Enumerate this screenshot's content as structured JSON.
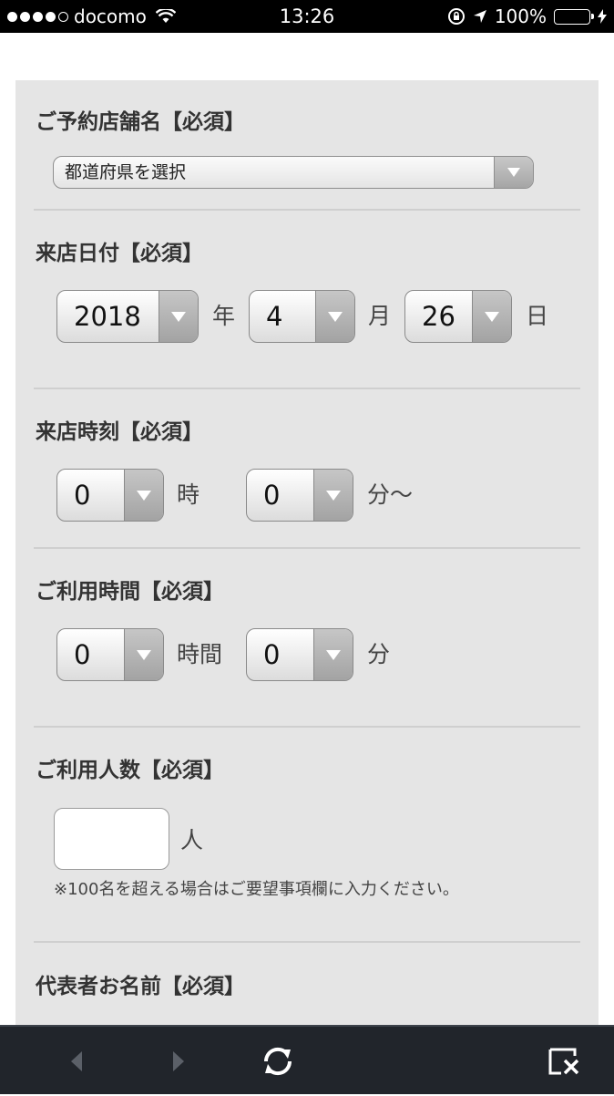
{
  "status_bar": {
    "carrier": "docomo",
    "time": "13:26",
    "battery": "100%",
    "signal_bars": 4,
    "signal_total": 5
  },
  "form": {
    "store": {
      "label": "ご予約店舗名【必須】",
      "prefecture_select": "都道府県を選択"
    },
    "visit_date": {
      "label": "来店日付【必須】",
      "year": "2018",
      "year_unit": "年",
      "month": "4",
      "month_unit": "月",
      "day": "26",
      "day_unit": "日"
    },
    "visit_time": {
      "label": "来店時刻【必須】",
      "hour": "0",
      "hour_unit": "時",
      "minute": "0",
      "minute_unit": "分〜"
    },
    "usage_time": {
      "label": "ご利用時間【必須】",
      "hours": "0",
      "hours_unit": "時間",
      "minutes": "0",
      "minutes_unit": "分"
    },
    "party_size": {
      "label": "ご利用人数【必須】",
      "value": "",
      "unit": "人",
      "note": "※100名を超える場合はご要望事項欄に入力ください。"
    },
    "representative_name": {
      "label": "代表者お名前【必須】"
    }
  },
  "colors": {
    "panel_bg": "#e5e5e5",
    "battery_fill": "#4cd964",
    "toolbar_bg": "#21252b"
  }
}
